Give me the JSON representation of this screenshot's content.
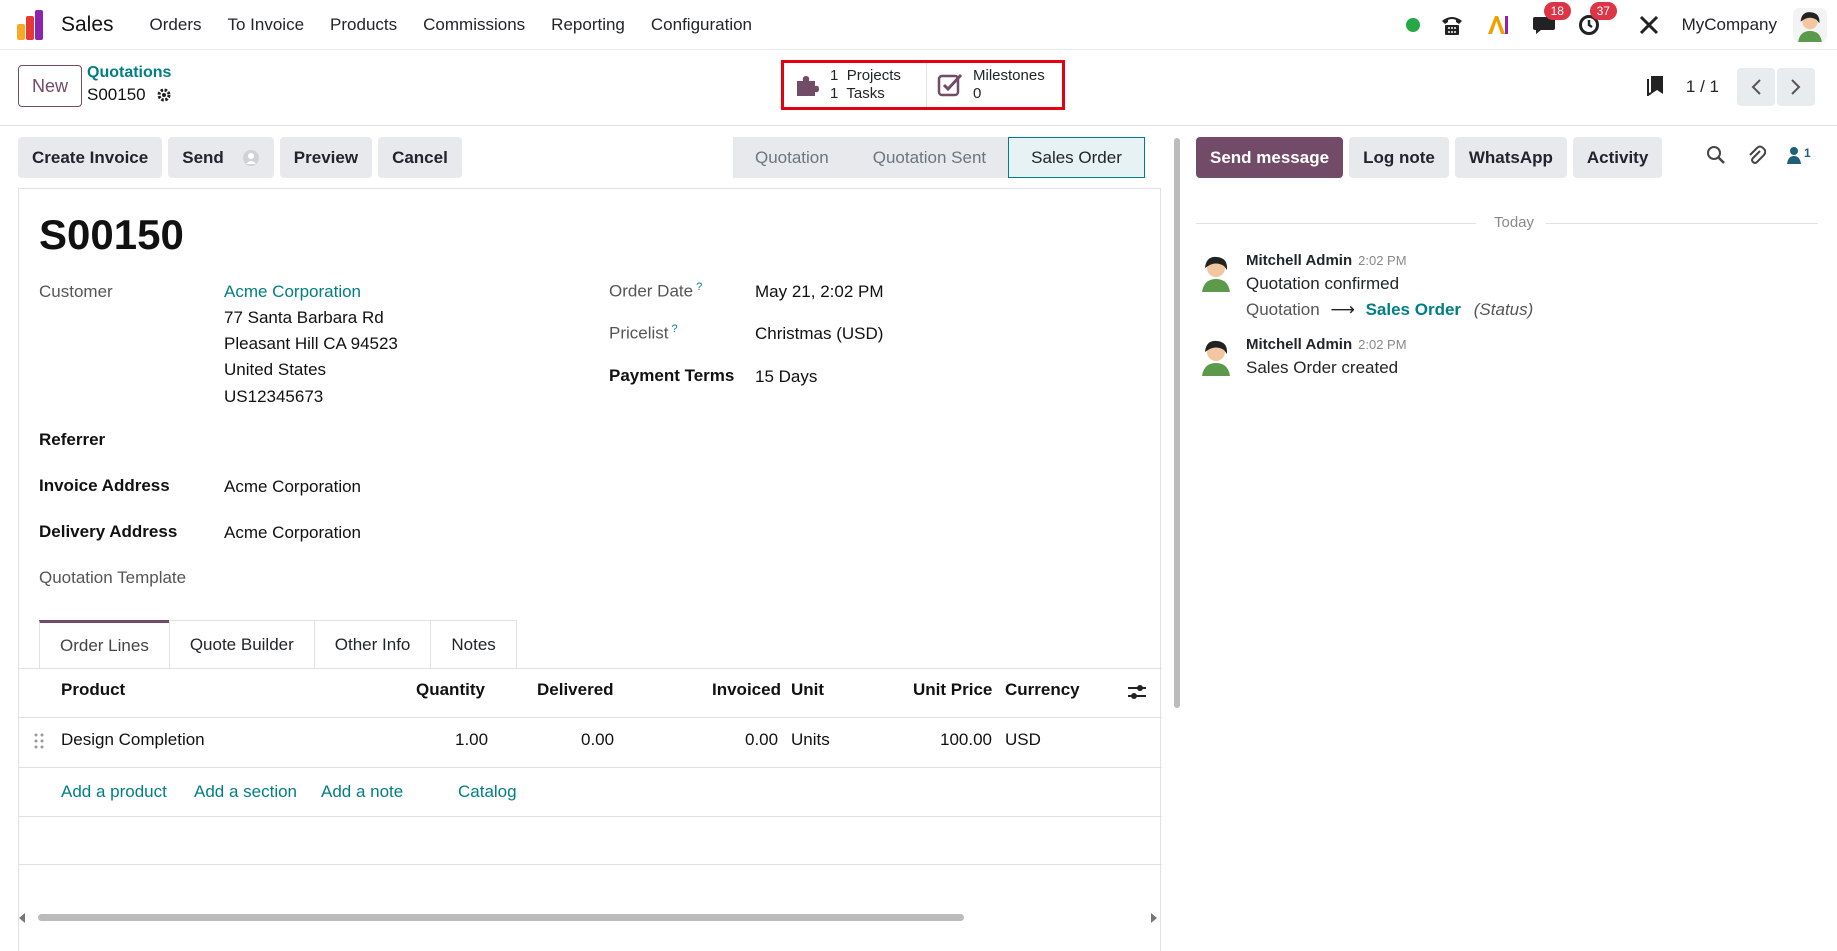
{
  "navbar": {
    "app_name": "Sales",
    "menu": [
      "Orders",
      "To Invoice",
      "Products",
      "Commissions",
      "Reporting",
      "Configuration"
    ],
    "messages_badge": "18",
    "activities_badge": "37",
    "company": "MyCompany"
  },
  "control": {
    "new_label": "New",
    "breadcrumb": "Quotations",
    "record": "S00150",
    "smart_buttons": {
      "projects_count": "1",
      "projects_label": "Projects",
      "tasks_count": "1",
      "tasks_label": "Tasks",
      "milestones_label": "Milestones",
      "milestones_count": "0"
    },
    "pager": "1 / 1"
  },
  "actions": {
    "create_invoice": "Create Invoice",
    "send": "Send",
    "preview": "Preview",
    "cancel": "Cancel"
  },
  "status": {
    "stages": [
      "Quotation",
      "Quotation Sent",
      "Sales Order"
    ],
    "active": "Sales Order"
  },
  "form": {
    "title": "S00150",
    "customer_label": "Customer",
    "customer_name": "Acme Corporation",
    "address_lines": [
      "77 Santa Barbara Rd",
      "Pleasant Hill CA 94523",
      "United States",
      "US12345673"
    ],
    "referrer_label": "Referrer",
    "invoice_address_label": "Invoice Address",
    "invoice_address": "Acme Corporation",
    "delivery_address_label": "Delivery Address",
    "delivery_address": "Acme Corporation",
    "template_label": "Quotation Template",
    "order_date_label": "Order Date",
    "order_date": "May 21, 2:02 PM",
    "pricelist_label": "Pricelist",
    "pricelist": "Christmas (USD)",
    "payment_terms_label": "Payment Terms",
    "payment_terms": "15 Days",
    "help_mark": "?"
  },
  "tabs": [
    "Order Lines",
    "Quote Builder",
    "Other Info",
    "Notes"
  ],
  "table": {
    "headers": {
      "product": "Product",
      "quantity": "Quantity",
      "delivered": "Delivered",
      "invoiced": "Invoiced",
      "unit": "Unit",
      "unit_price": "Unit Price",
      "currency": "Currency"
    },
    "rows": [
      {
        "product": "Design Completion",
        "quantity": "1.00",
        "delivered": "0.00",
        "invoiced": "0.00",
        "unit": "Units",
        "unit_price": "100.00",
        "currency": "USD"
      }
    ],
    "add_links": [
      "Add a product",
      "Add a section",
      "Add a note",
      "Catalog"
    ]
  },
  "chatter": {
    "send_message": "Send message",
    "log_note": "Log note",
    "whatsapp": "WhatsApp",
    "activity": "Activity",
    "followers_count": "1",
    "today": "Today",
    "messages": [
      {
        "author": "Mitchell Admin",
        "time": "2:02 PM",
        "body": "Quotation confirmed",
        "track_from": "Quotation",
        "track_arrow": "⟶",
        "track_to": "Sales Order",
        "track_field": "(Status)"
      },
      {
        "author": "Mitchell Admin",
        "time": "2:02 PM",
        "body": "Sales Order created"
      }
    ]
  }
}
